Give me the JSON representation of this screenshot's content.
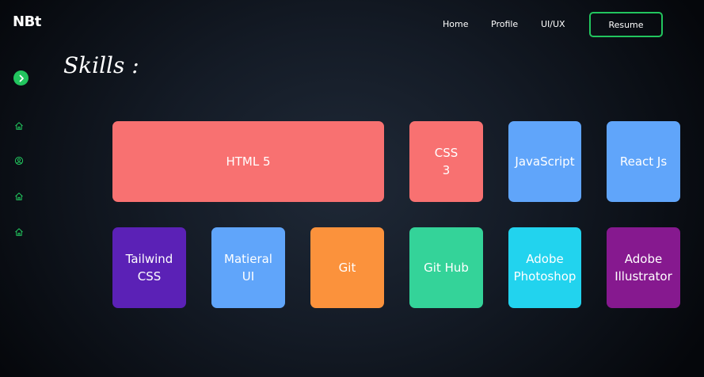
{
  "brand": {
    "logo_text": "NBt"
  },
  "nav": {
    "home": "Home",
    "profile": "Profile",
    "uiux": "UI/UX",
    "resume": "Resume"
  },
  "sidebar": {
    "toggle_icon": "chevron-right-icon",
    "items": [
      {
        "icon": "home-icon"
      },
      {
        "icon": "user-circle-icon"
      },
      {
        "icon": "home-icon"
      },
      {
        "icon": "home-icon"
      }
    ]
  },
  "section": {
    "title": "Skills :"
  },
  "skills": [
    {
      "lines": [
        "HTML 5"
      ],
      "color": "#f87171"
    },
    {
      "lines": [
        "CSS",
        "3"
      ],
      "color": "#f87171"
    },
    {
      "lines": [
        "JavaScript"
      ],
      "color": "#60a5fa"
    },
    {
      "lines": [
        "React Js"
      ],
      "color": "#60a5fa"
    },
    {
      "lines": [
        "Tailwind",
        "CSS"
      ],
      "color": "#5b21b6"
    },
    {
      "lines": [
        "Matieral",
        "UI"
      ],
      "color": "#60a5fa"
    },
    {
      "lines": [
        "Git"
      ],
      "color": "#fb923c"
    },
    {
      "lines": [
        "Git Hub"
      ],
      "color": "#34d399"
    },
    {
      "lines": [
        "Adobe",
        "Photoshop"
      ],
      "color": "#22d3ee"
    },
    {
      "lines": [
        "Adobe",
        "Illustrator"
      ],
      "color": "#86198f"
    }
  ],
  "colors": {
    "accent": "#22c55e",
    "background": "#141b26"
  }
}
